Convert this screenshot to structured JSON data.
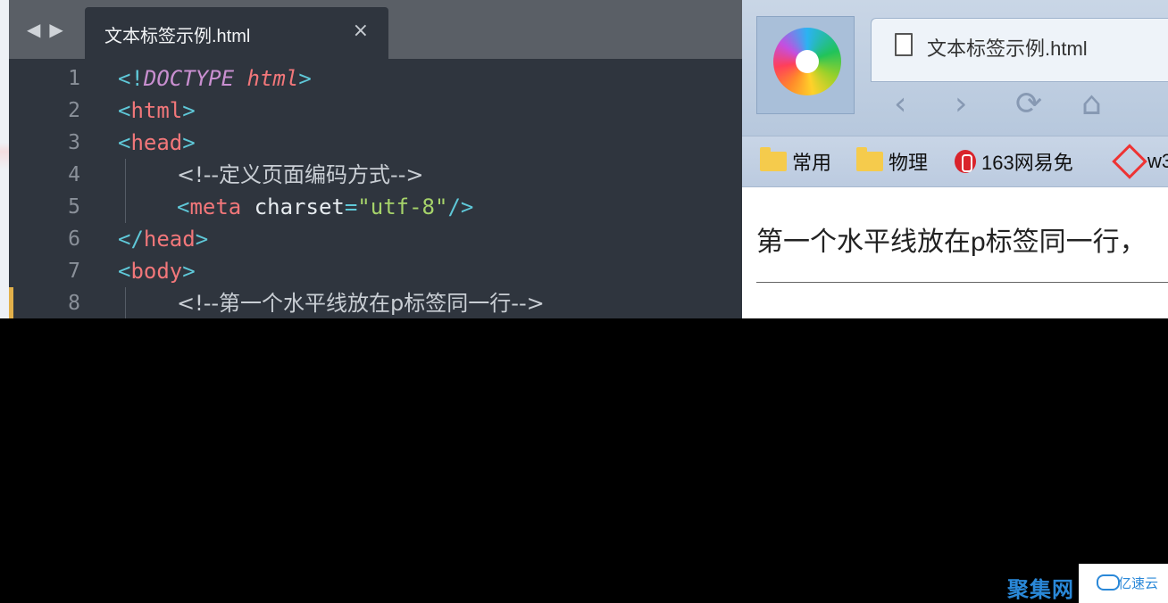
{
  "editor": {
    "nav_back": "◀",
    "nav_forward": "▶",
    "tab_title": "文本标签示例.html",
    "tab_close": "×",
    "lines": [
      {
        "n": "1"
      },
      {
        "n": "2"
      },
      {
        "n": "3"
      },
      {
        "n": "4"
      },
      {
        "n": "5"
      },
      {
        "n": "6"
      },
      {
        "n": "7"
      },
      {
        "n": "8"
      }
    ],
    "code": {
      "l1": {
        "open": "<!",
        "doctype": "DOCTYPE",
        "html": "html",
        "close": ">"
      },
      "l2": {
        "open": "<",
        "tag": "html",
        "close": ">"
      },
      "l3": {
        "open": "<",
        "tag": "head",
        "close": ">"
      },
      "l4": {
        "comment": "<!--定义页面编码方式-->"
      },
      "l5": {
        "open": "<",
        "tag": "meta",
        "attr": " charset",
        "eq": "=",
        "value": "\"utf-8\"",
        "close": "/>"
      },
      "l6": {
        "open": "</",
        "tag": "head",
        "close": ">"
      },
      "l7": {
        "open": "<",
        "tag": "body",
        "close": ">"
      },
      "l8": {
        "comment": "<!--第一个水平线放在p标签同一行-->"
      }
    },
    "colors": {
      "tag": "#f2777a",
      "bracket": "#5fc8d8",
      "string": "#a6d36a",
      "keyword": "#c98fd0"
    }
  },
  "browser": {
    "tab_title": "文本标签示例.html",
    "nav": {
      "back": "‹",
      "forward": "›",
      "reload": "⟳",
      "home": "⌂"
    },
    "bookmarks": [
      {
        "label": "常用",
        "icon": "folder-icon"
      },
      {
        "label": "物理",
        "icon": "folder-icon"
      },
      {
        "label": "163网易免",
        "icon": "netease-icon"
      },
      {
        "label": "w3",
        "icon": "w3school-icon"
      }
    ],
    "page": {
      "paragraph": "第一个水平线放在p标签同一行，"
    }
  },
  "watermark": {
    "cn": "聚集网",
    "name": "亿速云"
  }
}
